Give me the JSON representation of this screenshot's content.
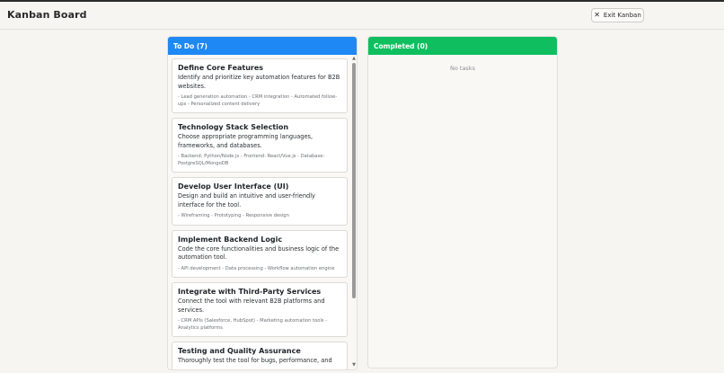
{
  "app": {
    "title": "Kanban Board",
    "exit_label": "Exit Kanban"
  },
  "columns": {
    "todo": {
      "header": "To Do (7)",
      "cards": [
        {
          "title": "Define Core Features",
          "desc": "Identify and prioritize key automation features for B2B websites.",
          "tags": "- Lead generation automation - CRM integration - Automated follow-ups - Personalized content delivery"
        },
        {
          "title": "Technology Stack Selection",
          "desc": "Choose appropriate programming languages, frameworks, and databases.",
          "tags": "- Backend: Python/Node.js - Frontend: React/Vue.js - Database: PostgreSQL/MongoDB"
        },
        {
          "title": "Develop User Interface (UI)",
          "desc": "Design and build an intuitive and user-friendly interface for the tool.",
          "tags": "- Wireframing - Prototyping - Responsive design"
        },
        {
          "title": "Implement Backend Logic",
          "desc": "Code the core functionalities and business logic of the automation tool.",
          "tags": "- API development - Data processing - Workflow automation engine"
        },
        {
          "title": "Integrate with Third-Party Services",
          "desc": "Connect the tool with relevant B2B platforms and services.",
          "tags": "- CRM APIs (Salesforce, HubSpot) - Marketing automation tools - Analytics platforms"
        },
        {
          "title": "Testing and Quality Assurance",
          "desc": "Thoroughly test the tool for bugs, performance, and",
          "tags": ""
        }
      ]
    },
    "completed": {
      "header": "Completed (0)",
      "empty": "No tasks"
    }
  },
  "colors": {
    "todo_header": "#1e88f5",
    "completed_header": "#0fbf5f"
  },
  "icons": {
    "exit": "close-icon"
  }
}
